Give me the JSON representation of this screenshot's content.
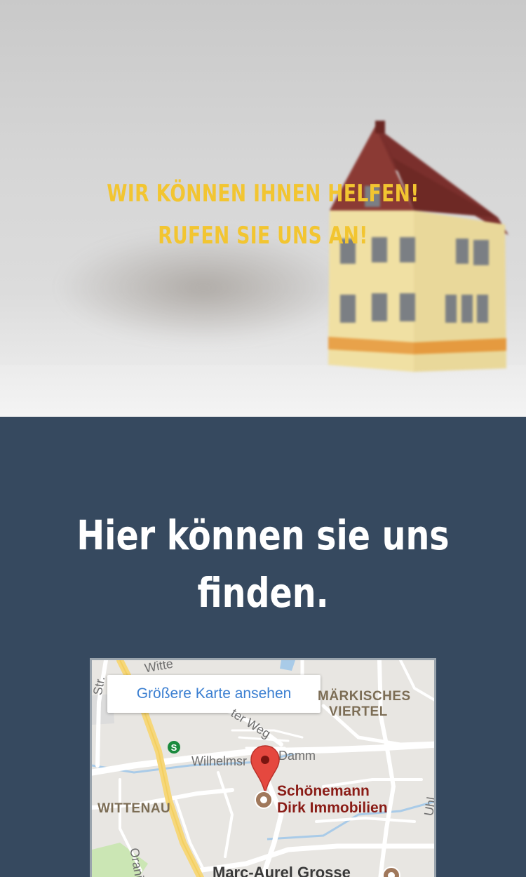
{
  "hero": {
    "line1": "WIR KÖNNEN IHNEN HELFEN!",
    "line2": "RUFEN SIE UNS AN!"
  },
  "location": {
    "title_line1": "Hier können sie uns",
    "title_line2": "finden."
  },
  "map": {
    "larger_map_link": "Größere Karte ansehen",
    "district_1_line1": "MÄRKISCHES",
    "district_1_line2": "VIERTEL",
    "district_2": "WITTENAU",
    "street_1": "Wilhelmsr",
    "street_2": "Damm",
    "street_3": "ter Weg",
    "street_4": "Witte",
    "street_5": "Oranienb",
    "street_6": "Uhl",
    "street_7": "Str.",
    "business_line1": "Schönemann",
    "business_line2": "Dirk Immobilien",
    "poi": "Marc-Aurel Grosse",
    "transit_icon_label": "S"
  },
  "colors": {
    "hero_text": "#f2c531",
    "section_bg": "#36495f",
    "link": "#3b7fd1",
    "business_label": "#8a1c16",
    "pin": "#e5483f"
  },
  "icons": {
    "pin": "map-pin-icon",
    "transit": "s-bahn-icon",
    "poi_marker": "poi-marker-icon"
  }
}
